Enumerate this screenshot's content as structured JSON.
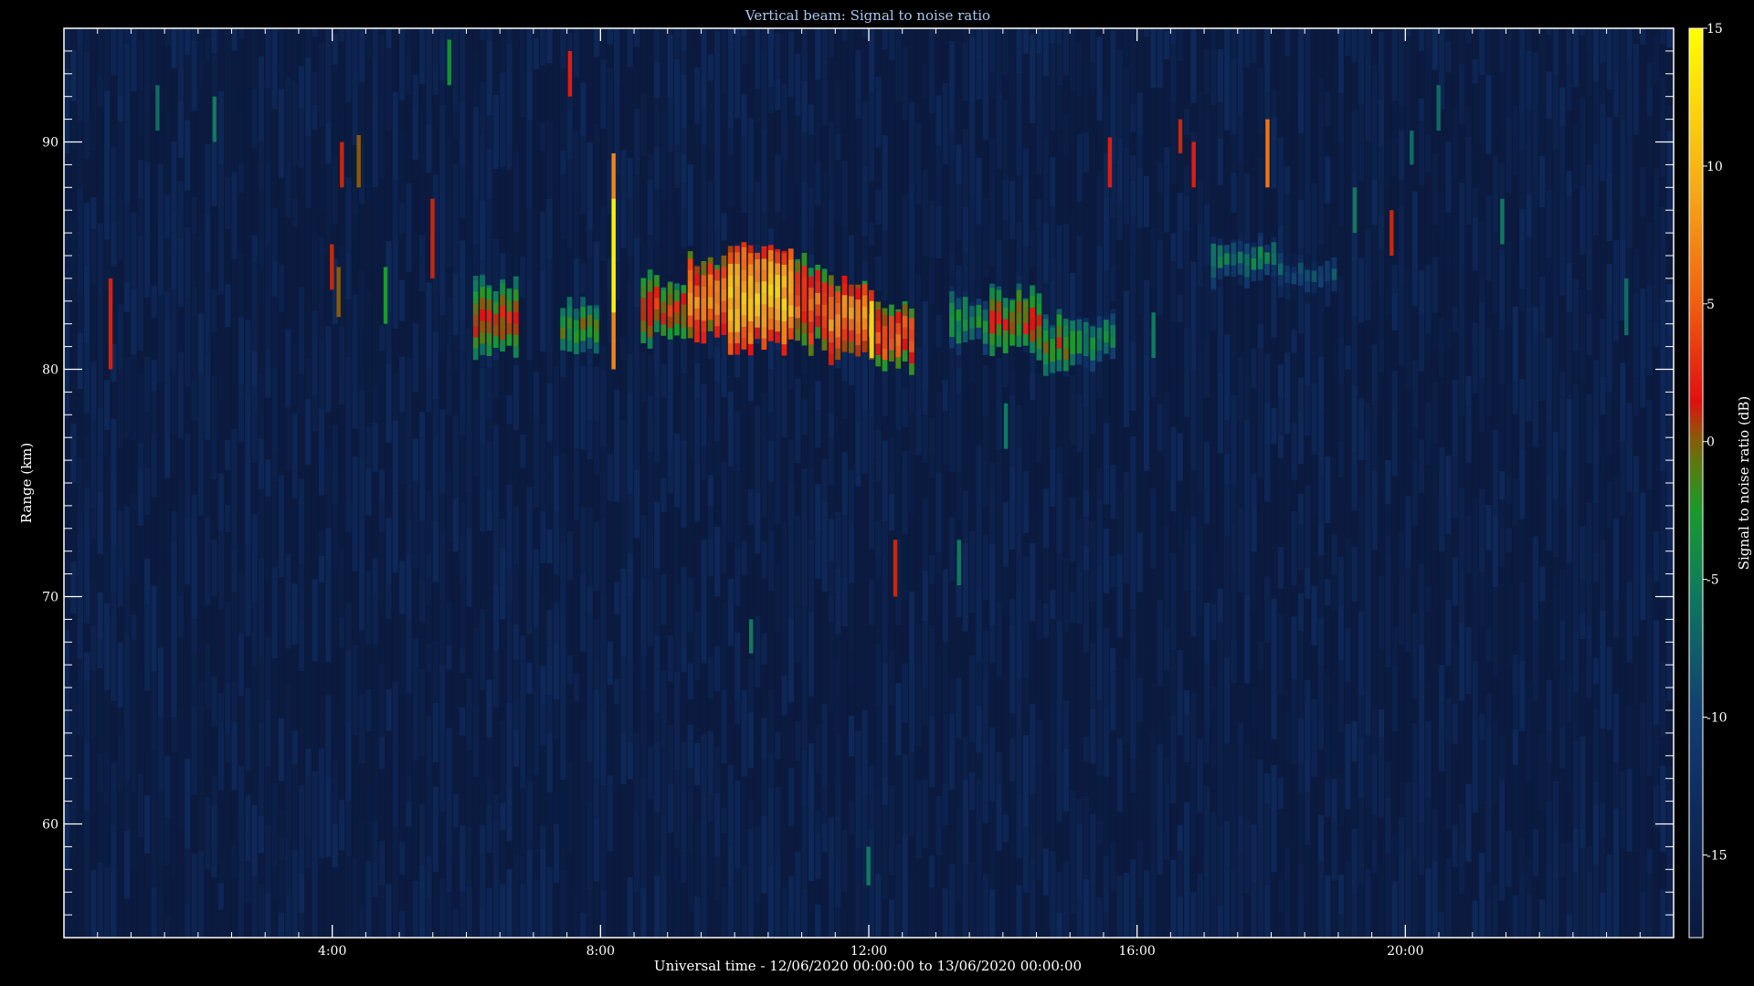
{
  "chart_data": {
    "type": "heatmap",
    "title": "Vertical beam: Signal to noise ratio",
    "xlabel": "Universal time - 12/06/2020 00:00:00 to 13/06/2020 00:00:00",
    "ylabel": "Range (km)",
    "colorbar_label": "Signal to noise ratio (dB)",
    "x_unit": "hours UT",
    "xlim": [
      0,
      24
    ],
    "ylim": [
      55,
      95
    ],
    "zlim": [
      -18,
      15
    ],
    "x_ticks": [
      4,
      8,
      12,
      16,
      20
    ],
    "x_tick_labels": [
      "4:00",
      "8:00",
      "12:00",
      "16:00",
      "20:00"
    ],
    "y_ticks": [
      60,
      70,
      80,
      90
    ],
    "y_tick_labels": [
      "60",
      "70",
      "80",
      "90"
    ],
    "colorbar_ticks": [
      -15,
      -10,
      -5,
      0,
      5,
      10,
      15
    ],
    "colorbar_tick_labels": [
      "-15",
      "-10",
      "-5",
      "0",
      "5",
      "10",
      "15"
    ],
    "time_step_hours": 0.1,
    "range_step_km": 0.5,
    "background_snr_db": -17,
    "layer_regions": [
      {
        "t_start": 6.1,
        "t_end": 6.8,
        "range_low": 80.8,
        "range_high": 83.8,
        "snr_db": 1
      },
      {
        "t_start": 7.4,
        "t_end": 8.0,
        "range_low": 80.8,
        "range_high": 82.8,
        "snr_db": -2
      },
      {
        "t_start": 8.6,
        "t_end": 9.3,
        "range_low": 81.3,
        "range_high": 84.0,
        "snr_db": 2
      },
      {
        "t_start": 9.3,
        "t_end": 9.9,
        "range_low": 81.3,
        "range_high": 84.8,
        "snr_db": 7
      },
      {
        "t_start": 9.9,
        "t_end": 10.9,
        "range_low": 81.0,
        "range_high": 85.5,
        "snr_db": 10
      },
      {
        "t_start": 10.9,
        "t_end": 11.4,
        "range_low": 81.0,
        "range_high": 84.8,
        "snr_db": 5
      },
      {
        "t_start": 11.4,
        "t_end": 12.1,
        "range_low": 80.5,
        "range_high": 83.8,
        "snr_db": 7
      },
      {
        "t_start": 12.1,
        "t_end": 12.7,
        "range_low": 80.0,
        "range_high": 83.0,
        "snr_db": 5
      },
      {
        "t_start": 13.2,
        "t_end": 13.8,
        "range_low": 81.0,
        "range_high": 83.3,
        "snr_db": -4
      },
      {
        "t_start": 13.8,
        "t_end": 14.6,
        "range_low": 80.8,
        "range_high": 83.5,
        "snr_db": 1
      },
      {
        "t_start": 14.6,
        "t_end": 15.1,
        "range_low": 79.8,
        "range_high": 82.3,
        "snr_db": -1
      },
      {
        "t_start": 15.1,
        "t_end": 15.7,
        "range_low": 80.3,
        "range_high": 82.3,
        "snr_db": -5
      },
      {
        "t_start": 17.1,
        "t_end": 18.1,
        "range_low": 83.8,
        "range_high": 85.8,
        "snr_db": -6
      },
      {
        "t_start": 18.1,
        "t_end": 19.0,
        "range_low": 83.5,
        "range_high": 84.8,
        "snr_db": -8
      }
    ],
    "echo_streaks": [
      {
        "t": 0.65,
        "range_low": 80.0,
        "range_high": 84.0,
        "snr_db": 2
      },
      {
        "t": 1.35,
        "range_low": 90.5,
        "range_high": 92.5,
        "snr_db": -7
      },
      {
        "t": 2.2,
        "range_low": 90.0,
        "range_high": 92.0,
        "snr_db": -6
      },
      {
        "t": 4.1,
        "range_low": 88.0,
        "range_high": 90.0,
        "snr_db": 1
      },
      {
        "t": 4.05,
        "range_low": 82.3,
        "range_high": 84.5,
        "snr_db": 0
      },
      {
        "t": 4.35,
        "range_low": 88.0,
        "range_high": 90.3,
        "snr_db": 0
      },
      {
        "t": 3.95,
        "range_low": 83.5,
        "range_high": 85.5,
        "snr_db": 1
      },
      {
        "t": 4.75,
        "range_low": 82.0,
        "range_high": 84.5,
        "snr_db": -3
      },
      {
        "t": 5.45,
        "range_low": 84.0,
        "range_high": 87.5,
        "snr_db": 1
      },
      {
        "t": 5.7,
        "range_low": 92.5,
        "range_high": 94.5,
        "snr_db": -4
      },
      {
        "t": 7.5,
        "range_low": 92.0,
        "range_high": 94.0,
        "snr_db": 2
      },
      {
        "t": 8.15,
        "range_low": 80.0,
        "range_high": 89.5,
        "snr_db": 7
      },
      {
        "t": 8.15,
        "range_low": 82.5,
        "range_high": 87.5,
        "snr_db": 14
      },
      {
        "t": 12.35,
        "range_low": 70.0,
        "range_high": 72.5,
        "snr_db": 1
      },
      {
        "t": 10.2,
        "range_low": 67.5,
        "range_high": 69.0,
        "snr_db": -6
      },
      {
        "t": 12.0,
        "range_low": 80.5,
        "range_high": 83.0,
        "snr_db": 12
      },
      {
        "t": 15.55,
        "range_low": 88.0,
        "range_high": 90.2,
        "snr_db": 2
      },
      {
        "t": 16.6,
        "range_low": 89.5,
        "range_high": 91.0,
        "snr_db": 1
      },
      {
        "t": 16.8,
        "range_low": 88.0,
        "range_high": 90.0,
        "snr_db": 2
      },
      {
        "t": 17.9,
        "range_low": 88.0,
        "range_high": 91.0,
        "snr_db": 6
      },
      {
        "t": 19.75,
        "range_low": 85.0,
        "range_high": 87.0,
        "snr_db": 1
      },
      {
        "t": 13.3,
        "range_low": 70.5,
        "range_high": 72.5,
        "snr_db": -6
      },
      {
        "t": 14.0,
        "range_low": 76.5,
        "range_high": 78.5,
        "snr_db": -6
      },
      {
        "t": 11.95,
        "range_low": 57.3,
        "range_high": 59.0,
        "snr_db": -6
      },
      {
        "t": 19.2,
        "range_low": 86.0,
        "range_high": 88.0,
        "snr_db": -6
      },
      {
        "t": 21.4,
        "range_low": 85.5,
        "range_high": 87.5,
        "snr_db": -6
      },
      {
        "t": 23.25,
        "range_low": 81.5,
        "range_high": 84.0,
        "snr_db": -7
      },
      {
        "t": 16.2,
        "range_low": 80.5,
        "range_high": 82.5,
        "snr_db": -6
      },
      {
        "t": 20.05,
        "range_low": 89.0,
        "range_high": 90.5,
        "snr_db": -7
      },
      {
        "t": 20.45,
        "range_low": 90.5,
        "range_high": 92.5,
        "snr_db": -7
      }
    ],
    "grid": false,
    "legend": "colorbar-right"
  }
}
